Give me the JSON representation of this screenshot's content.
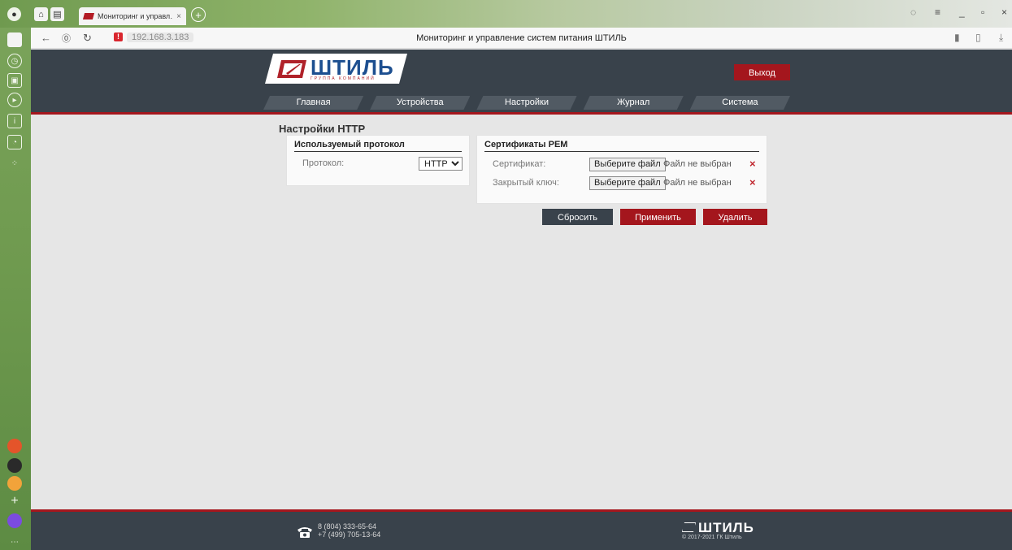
{
  "browser": {
    "tab_title": "Мониторинг и управл…",
    "tab_close": "×",
    "new_tab": "+",
    "url": "192.168.3.183",
    "page_title": "Мониторинг и управление систем питания ШТИЛЬ",
    "window_controls": {
      "minimize": "_",
      "restore": "▫",
      "close": "×"
    }
  },
  "site": {
    "brand": "ШТИЛЬ",
    "brand_sub": "ГРУППА КОМПАНИЙ",
    "logout": "Выход",
    "nav": [
      "Главная",
      "Устройства",
      "Настройки",
      "Журнал",
      "Система"
    ]
  },
  "page": {
    "title": "Настройки HTTP",
    "protocol_panel": {
      "heading": "Используемый протокол",
      "protocol_label": "Протокол:",
      "protocol_value": "HTTP"
    },
    "cert_panel": {
      "heading": "Сертификаты PEM",
      "rows": [
        {
          "label": "Сертификат:",
          "button": "Выберите файл",
          "status": "Файл не выбран",
          "remove": "×"
        },
        {
          "label": "Закрытый ключ:",
          "button": "Выберите файл",
          "status": "Файл не выбран",
          "remove": "×"
        }
      ]
    },
    "buttons": {
      "reset": "Сбросить",
      "apply": "Применить",
      "delete": "Удалить"
    }
  },
  "footer": {
    "phone1": "8 (804) 333-65-64",
    "phone2": "+7 (499) 705-13-64",
    "brand": "ШТИЛЬ",
    "copyright": "© 2017-2021 ГК Штиль"
  },
  "colors": {
    "accent_red": "#a4161d",
    "header_dark": "#39424b",
    "reset_button": "#39424b",
    "brand_blue": "#1d4f90"
  }
}
